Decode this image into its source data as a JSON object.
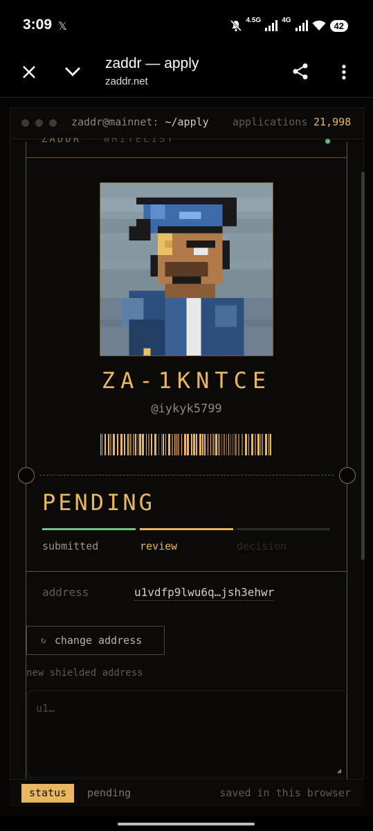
{
  "statusbar": {
    "time": "3:09",
    "notification": "𝕏",
    "network1": "4.5G",
    "network2": "4G",
    "battery": "42"
  },
  "browser": {
    "title": "zaddr — apply",
    "url": "zaddr.net"
  },
  "terminal": {
    "user_host": "zaddr@mainnet:",
    "path": "~/apply",
    "applications_label": "applications",
    "applications_count": "21,998"
  },
  "card": {
    "header_left": "ZADDR",
    "header_right": "WHITELIST",
    "id": "ZA-1KNTCE",
    "handle": "@iykyk5799",
    "status": "PENDING",
    "steps": [
      {
        "label": "submitted",
        "color": "#6fc488",
        "text_color": "#9a968b"
      },
      {
        "label": "review",
        "color": "#e8b760",
        "text_color": "#e8b760"
      },
      {
        "label": "decision",
        "color": "#2c2c29",
        "text_color": "#2e2d29"
      }
    ],
    "address_label": "address",
    "address_value": "u1vdfp9lwu6q…jsh3ehwr"
  },
  "form": {
    "change_button": "change address",
    "new_address_label": "new shielded address",
    "new_address_placeholder": "u1…"
  },
  "footer": {
    "tab": "status",
    "state": "pending",
    "note": "saved in this browser"
  },
  "colors": {
    "accent": "#e8b760",
    "success": "#6fc488",
    "border": "#6b5731"
  },
  "icons": [
    "close-icon",
    "chevron-down-icon",
    "share-icon",
    "more-vert-icon",
    "refresh-icon",
    "wifi-icon",
    "mute-icon"
  ]
}
